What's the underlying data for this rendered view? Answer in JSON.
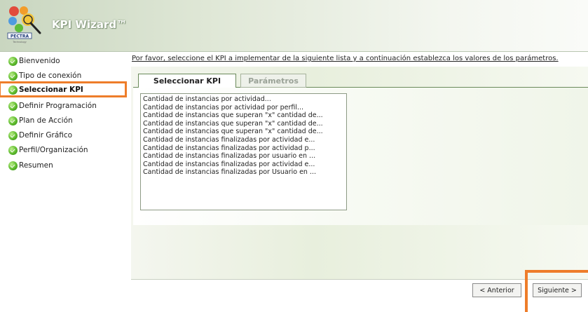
{
  "header": {
    "title": "KPI Wizard™",
    "logo_text": "PECTRA",
    "logo_subtext": "Technology"
  },
  "sidebar": {
    "items": [
      {
        "label": "Bienvenido"
      },
      {
        "label": "Tipo de conexión"
      },
      {
        "label": "Seleccionar KPI",
        "active": true
      },
      {
        "label": "Definir Programación"
      },
      {
        "label": "Plan de Acción"
      },
      {
        "label": "Definir Gráfico"
      },
      {
        "label": "Perfil/Organización"
      },
      {
        "label": "Resumen"
      }
    ]
  },
  "main": {
    "instruction": "Por favor, seleccione el KPI a implementar de la siguiente lista y a continuación establezca los valores de los parámetros.",
    "tabs": [
      {
        "label": "Seleccionar KPI",
        "active": true
      },
      {
        "label": "Parámetros",
        "active": false
      }
    ],
    "kpi_list": [
      "Cantidad de instancias por actividad...",
      "Cantidad de instancias por actividad por perfil...",
      "Cantidad de instancias que superan \"x\" cantidad de...",
      "Cantidad de instancias que superan \"x\" cantidad de...",
      "Cantidad de instancias que superan \"x\" cantidad de...",
      "Cantidad de instancias finalizadas por actividad e...",
      "Cantidad de instancias finalizadas por actividad p...",
      "Cantidad de instancias finalizadas por usuario en ...",
      "Cantidad de instancias finalizadas por actividad e...",
      "Cantidad de instancias finalizadas por Usuario en ..."
    ]
  },
  "footer": {
    "prev_label": "< Anterior",
    "next_label": "Siguiente >"
  },
  "colors": {
    "highlight": "#ee7d2a",
    "step_icon": "#5dbb2c"
  }
}
